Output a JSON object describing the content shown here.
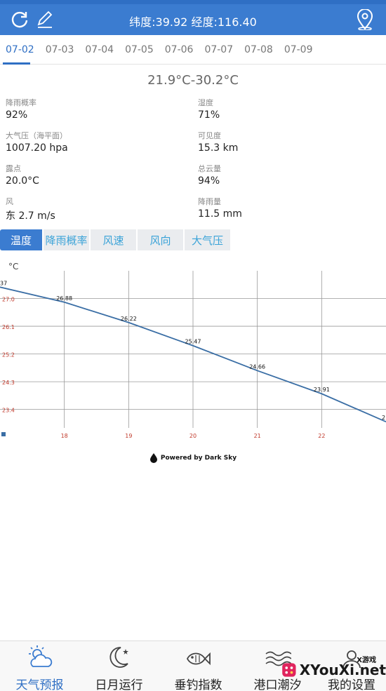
{
  "header": {
    "coords": "纬度:39.92 经度:116.40"
  },
  "date_tabs": [
    {
      "label": "07-02",
      "active": true
    },
    {
      "label": "07-03"
    },
    {
      "label": "07-04"
    },
    {
      "label": "07-05"
    },
    {
      "label": "07-06"
    },
    {
      "label": "07-07"
    },
    {
      "label": "07-08"
    },
    {
      "label": "07-09"
    }
  ],
  "temp_range": "21.9°C-30.2°C",
  "details": [
    {
      "label": "降雨概率",
      "value": "92%"
    },
    {
      "label": "湿度",
      "value": "71%"
    },
    {
      "label": "大气压（海平面）",
      "value": "1007.20 hpa"
    },
    {
      "label": "可见度",
      "value": "15.3 km"
    },
    {
      "label": "露点",
      "value": "20.0°C"
    },
    {
      "label": "总云量",
      "value": "94%"
    },
    {
      "label": "风",
      "value": "东 2.7 m/s"
    },
    {
      "label": "降雨量",
      "value": "11.5 mm"
    }
  ],
  "chart_tabs": [
    {
      "label": "温度",
      "active": true
    },
    {
      "label": "降雨概率"
    },
    {
      "label": "风速"
    },
    {
      "label": "风向"
    },
    {
      "label": "大气压"
    }
  ],
  "chart_data": {
    "type": "line",
    "ylabel": "°C",
    "y_ticks": [
      "27.0",
      "26.1",
      "25.2",
      "24.3",
      "23.4"
    ],
    "x_ticks": [
      "18",
      "19",
      "20",
      "21",
      "22"
    ],
    "x": [
      17,
      18,
      19,
      20,
      21,
      22,
      23
    ],
    "values": [
      27.37,
      26.88,
      26.22,
      25.47,
      24.66,
      23.91,
      23.0
    ],
    "point_labels": [
      "37",
      "26.88",
      "26.22",
      "25.47",
      "24.66",
      "23.91",
      "2"
    ],
    "xlim": [
      17,
      23
    ],
    "ylim": [
      22.8,
      27.9
    ],
    "grid": true,
    "colors": {
      "line": "#3a6ea5",
      "tick_text": "#c0392b"
    }
  },
  "powered_by": "Powered by Dark Sky",
  "bottom_nav": [
    {
      "label": "天气预报",
      "icon": "weather-icon",
      "active": true
    },
    {
      "label": "日月运行",
      "icon": "moon-icon"
    },
    {
      "label": "垂钓指数",
      "icon": "fish-icon"
    },
    {
      "label": "港口潮汐",
      "icon": "tide-icon"
    },
    {
      "label": "我的设置",
      "icon": "settings-icon"
    }
  ],
  "watermark": {
    "text": "XYouXi.net",
    "small": "X游戏"
  },
  "colors": {
    "accent": "#3b7cd0",
    "tab_text": "#3ba3d8"
  }
}
